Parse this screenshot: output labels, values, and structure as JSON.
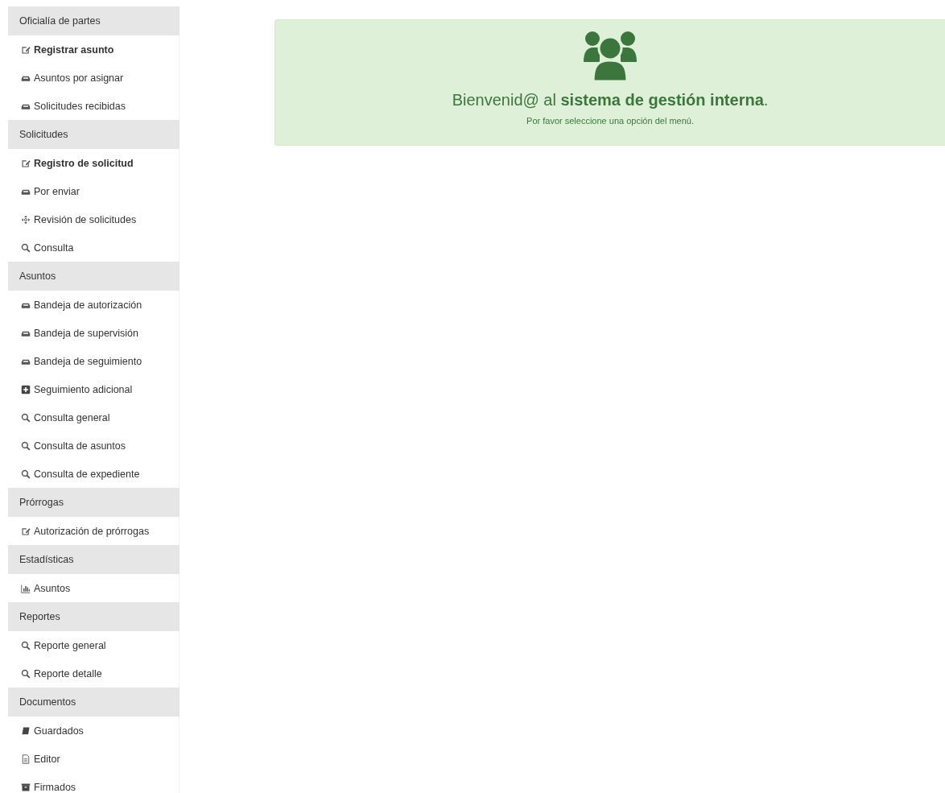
{
  "sidebar": {
    "sections": [
      {
        "title": "Oficialía de partes",
        "items": [
          {
            "label": "Registrar asunto",
            "kind": "edit",
            "bold": true
          },
          {
            "label": "Asuntos por asignar",
            "kind": "inbox",
            "bold": false
          },
          {
            "label": "Solicitudes recibidas",
            "kind": "inbox",
            "bold": false
          }
        ]
      },
      {
        "title": "Solicitudes",
        "items": [
          {
            "label": "Registro de solicitud",
            "kind": "edit",
            "bold": true
          },
          {
            "label": "Por enviar",
            "kind": "inbox",
            "bold": false
          },
          {
            "label": "Revisión de solicitudes",
            "kind": "move",
            "bold": false
          },
          {
            "label": "Consulta",
            "kind": "search",
            "bold": false
          }
        ]
      },
      {
        "title": "Asuntos",
        "items": [
          {
            "label": "Bandeja de autorización",
            "kind": "inbox",
            "bold": false
          },
          {
            "label": "Bandeja de supervisión",
            "kind": "inbox",
            "bold": false
          },
          {
            "label": "Bandeja de seguimiento",
            "kind": "inbox",
            "bold": false
          },
          {
            "label": "Seguimiento adicional",
            "kind": "plus",
            "bold": false
          },
          {
            "label": "Consulta general",
            "kind": "search",
            "bold": false
          },
          {
            "label": "Consulta de asuntos",
            "kind": "search",
            "bold": false
          },
          {
            "label": "Consulta de expediente",
            "kind": "search",
            "bold": false
          }
        ]
      },
      {
        "title": "Prórrogas",
        "items": [
          {
            "label": "Autorización de prórrogas",
            "kind": "edit",
            "bold": false
          }
        ]
      },
      {
        "title": "Estadísticas",
        "items": [
          {
            "label": "Asuntos",
            "kind": "chart",
            "bold": false
          }
        ]
      },
      {
        "title": "Reportes",
        "items": [
          {
            "label": "Reporte general",
            "kind": "search",
            "bold": false
          },
          {
            "label": "Reporte detalle",
            "kind": "search",
            "bold": false
          }
        ]
      },
      {
        "title": "Documentos",
        "items": [
          {
            "label": "Guardados",
            "kind": "book",
            "bold": false
          },
          {
            "label": "Editor",
            "kind": "file",
            "bold": false
          },
          {
            "label": "Firmados",
            "kind": "archive",
            "bold": false
          }
        ]
      }
    ]
  },
  "welcome": {
    "title": "Bienvenid@ al **sistema de gestión interna**.",
    "message": "Por favor seleccione una opción del menú."
  }
}
